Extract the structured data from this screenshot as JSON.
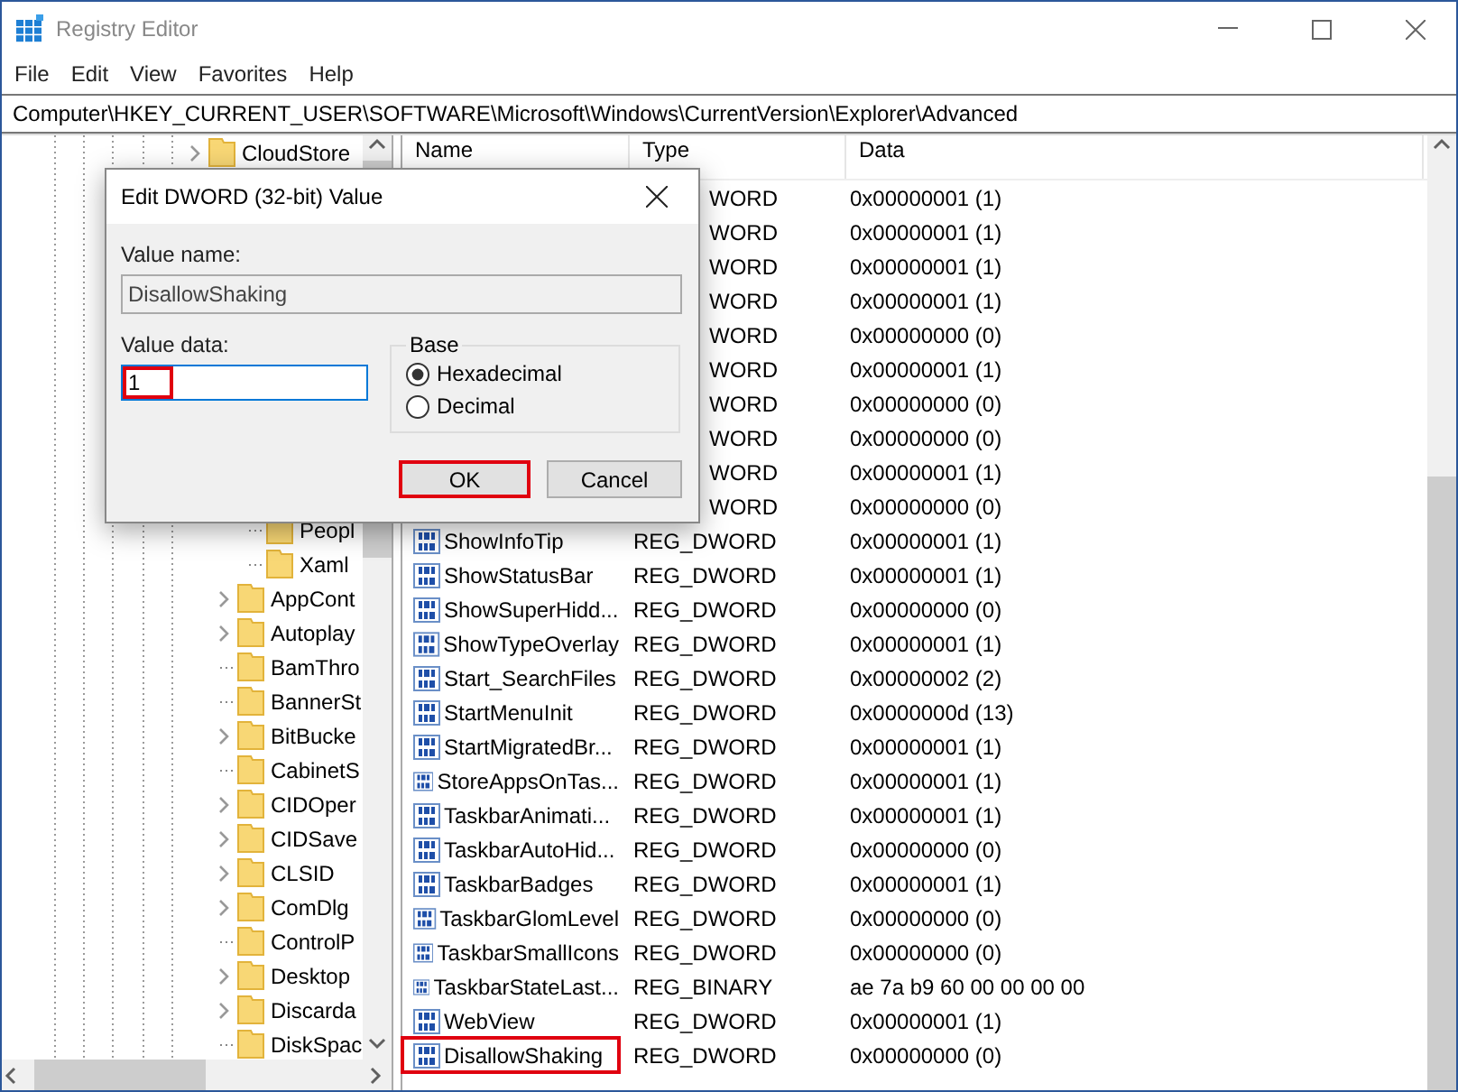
{
  "window": {
    "title": "Registry Editor"
  },
  "menu": [
    "File",
    "Edit",
    "View",
    "Favorites",
    "Help"
  ],
  "address": "Computer\\HKEY_CURRENT_USER\\SOFTWARE\\Microsoft\\Windows\\CurrentVersion\\Explorer\\Advanced",
  "tree": [
    {
      "label": "CloudStore",
      "expandable": true
    },
    {
      "children": [
        {
          "children": [
            {
              "label": "Peopl",
              "expandable": false
            },
            {
              "label": "Xaml",
              "expandable": false
            }
          ]
        },
        {
          "label": "AppCont",
          "expandable": true
        },
        {
          "label": "Autoplay",
          "expandable": true
        },
        {
          "label": "BamThro",
          "expandable": false
        },
        {
          "label": "BannerSt",
          "expandable": false
        },
        {
          "label": "BitBucke",
          "expandable": true
        },
        {
          "label": "CabinetS",
          "expandable": false
        },
        {
          "label": "CIDOper",
          "expandable": true
        },
        {
          "label": "CIDSave",
          "expandable": true
        },
        {
          "label": "CLSID",
          "expandable": true
        },
        {
          "label": "ComDlg",
          "expandable": true
        },
        {
          "label": "ControlP",
          "expandable": false
        },
        {
          "label": "Desktop",
          "expandable": true
        },
        {
          "label": "Discarda",
          "expandable": true
        },
        {
          "label": "DiskSpac",
          "expandable": false
        }
      ]
    }
  ],
  "table": {
    "columns": [
      "Name",
      "Type",
      "Data"
    ],
    "rows": [
      {
        "kind": "covered",
        "type": "WORD",
        "data": "0x00000001 (1)"
      },
      {
        "kind": "covered",
        "type": "WORD",
        "data": "0x00000001 (1)"
      },
      {
        "kind": "covered",
        "type": "WORD",
        "data": "0x00000001 (1)"
      },
      {
        "kind": "covered",
        "type": "WORD",
        "data": "0x00000001 (1)"
      },
      {
        "kind": "covered",
        "type": "WORD",
        "data": "0x00000000 (0)"
      },
      {
        "kind": "covered",
        "type": "WORD",
        "data": "0x00000001 (1)"
      },
      {
        "kind": "covered",
        "type": "WORD",
        "data": "0x00000000 (0)"
      },
      {
        "kind": "covered",
        "type": "WORD",
        "data": "0x00000000 (0)"
      },
      {
        "kind": "covered",
        "type": "WORD",
        "data": "0x00000001 (1)"
      },
      {
        "kind": "covered",
        "type": "WORD",
        "data": "0x00000000 (0)"
      },
      {
        "kind": "value",
        "name": "ShowInfoTip",
        "type": "REG_DWORD",
        "data": "0x00000001 (1)",
        "highlighted": false
      },
      {
        "kind": "value",
        "name": "ShowStatusBar",
        "type": "REG_DWORD",
        "data": "0x00000001 (1)",
        "highlighted": false
      },
      {
        "kind": "value",
        "name": "ShowSuperHidd...",
        "type": "REG_DWORD",
        "data": "0x00000000 (0)",
        "highlighted": false
      },
      {
        "kind": "value",
        "name": "ShowTypeOverlay",
        "type": "REG_DWORD",
        "data": "0x00000001 (1)",
        "highlighted": false
      },
      {
        "kind": "value",
        "name": "Start_SearchFiles",
        "type": "REG_DWORD",
        "data": "0x00000002 (2)",
        "highlighted": false
      },
      {
        "kind": "value",
        "name": "StartMenuInit",
        "type": "REG_DWORD",
        "data": "0x0000000d (13)",
        "highlighted": false
      },
      {
        "kind": "value",
        "name": "StartMigratedBr...",
        "type": "REG_DWORD",
        "data": "0x00000001 (1)",
        "highlighted": false
      },
      {
        "kind": "value",
        "name": "StoreAppsOnTas...",
        "type": "REG_DWORD",
        "data": "0x00000001 (1)",
        "highlighted": false
      },
      {
        "kind": "value",
        "name": "TaskbarAnimati...",
        "type": "REG_DWORD",
        "data": "0x00000001 (1)",
        "highlighted": false
      },
      {
        "kind": "value",
        "name": "TaskbarAutoHid...",
        "type": "REG_DWORD",
        "data": "0x00000000 (0)",
        "highlighted": false
      },
      {
        "kind": "value",
        "name": "TaskbarBadges",
        "type": "REG_DWORD",
        "data": "0x00000001 (1)",
        "highlighted": false
      },
      {
        "kind": "value",
        "name": "TaskbarGlomLevel",
        "type": "REG_DWORD",
        "data": "0x00000000 (0)",
        "highlighted": false
      },
      {
        "kind": "value",
        "name": "TaskbarSmallIcons",
        "type": "REG_DWORD",
        "data": "0x00000000 (0)",
        "highlighted": false
      },
      {
        "kind": "value",
        "name": "TaskbarStateLast...",
        "type": "REG_BINARY",
        "data": "ae 7a b9 60 00 00 00 00",
        "highlighted": false
      },
      {
        "kind": "value",
        "name": "WebView",
        "type": "REG_DWORD",
        "data": "0x00000001 (1)",
        "highlighted": false
      },
      {
        "kind": "value",
        "name": "DisallowShaking",
        "type": "REG_DWORD",
        "data": "0x00000000 (0)",
        "highlighted": true
      }
    ]
  },
  "dialog": {
    "title": "Edit DWORD (32-bit) Value",
    "value_name_label": "Value name:",
    "value_name": "DisallowShaking",
    "value_data_label": "Value data:",
    "value_data": "1",
    "value_data_highlighted": true,
    "base_label": "Base",
    "base_options": [
      {
        "label": "Hexadecimal",
        "selected": true
      },
      {
        "label": "Decimal",
        "selected": false
      }
    ],
    "buttons": [
      {
        "label": "OK",
        "highlighted": true
      },
      {
        "label": "Cancel",
        "highlighted": false
      }
    ]
  }
}
